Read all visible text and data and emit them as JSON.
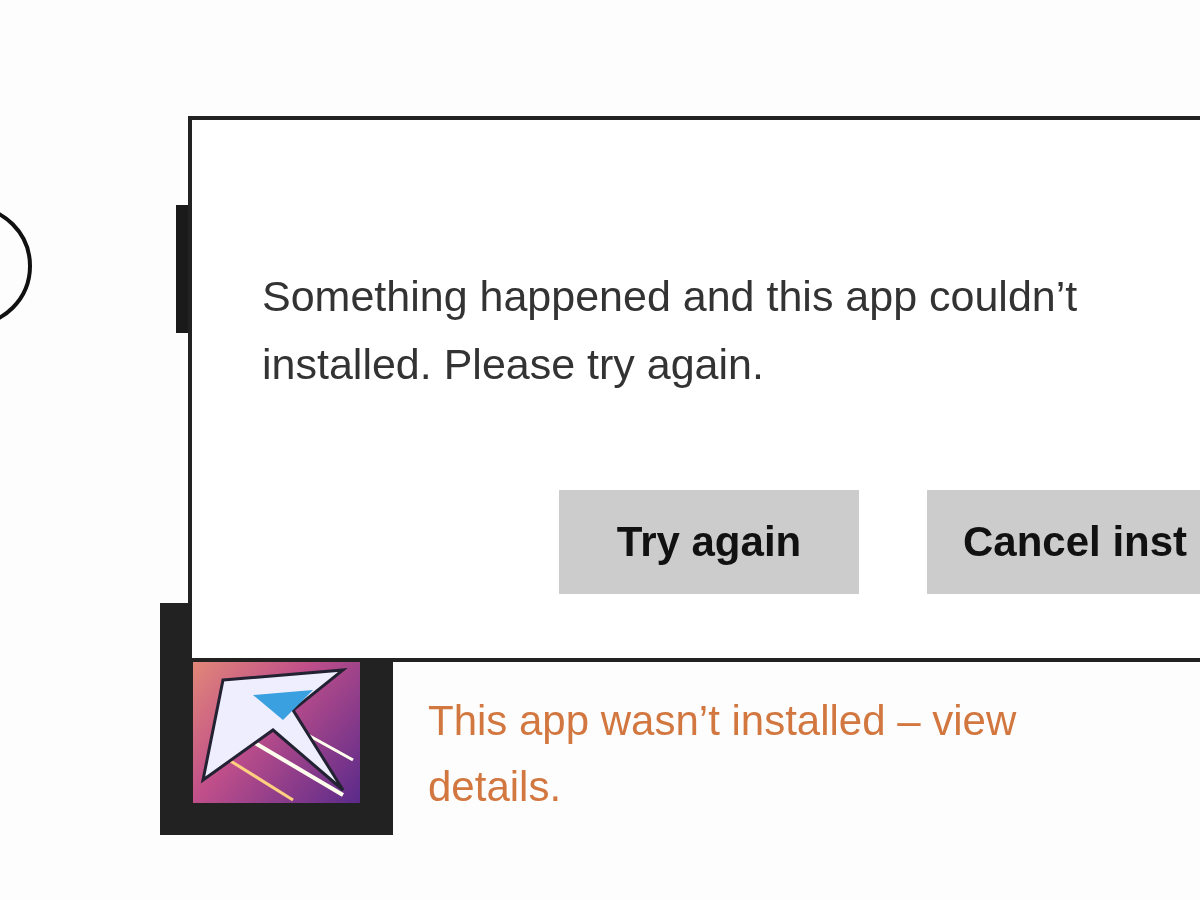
{
  "dialog": {
    "message_lines": [
      "Something happened and this app couldn’t",
      "installed. Please try again."
    ],
    "buttons": [
      {
        "label": "Try again"
      },
      {
        "label": "Cancel inst"
      }
    ]
  },
  "app_tile": {
    "status": "This app wasn’t installed – view details."
  }
}
